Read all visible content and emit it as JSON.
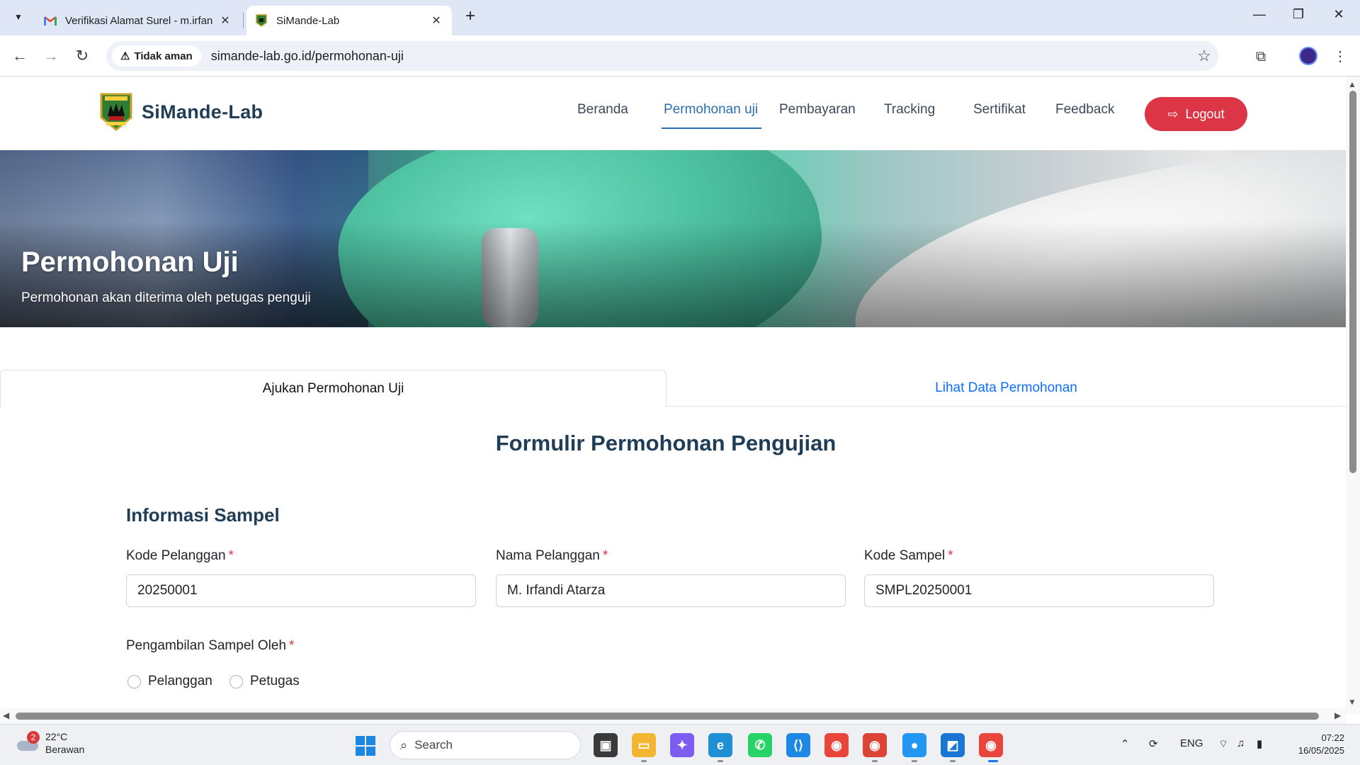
{
  "browser": {
    "tabs": [
      {
        "title": "Verifikasi Alamat Surel - m.irfan",
        "favicon": "gmail-icon",
        "active": false
      },
      {
        "title": "SiMande-Lab",
        "favicon": "simande-logo-icon",
        "active": true
      }
    ],
    "security_label": "Tidak aman",
    "url": "simande-lab.go.id/permohonan-uji"
  },
  "site": {
    "brand": "SiMande-Lab",
    "nav": {
      "beranda": "Beranda",
      "permohonan": "Permohonan uji",
      "pembayaran": "Pembayaran",
      "tracking": "Tracking",
      "sertifikat": "Sertifikat",
      "feedback": "Feedback"
    },
    "active_nav": "Permohonan uji",
    "logout": "Logout",
    "accent_color": "#dc3545",
    "link_color": "#2a6fb0"
  },
  "hero": {
    "title": "Permohonan Uji",
    "subtitle": "Permohonan akan diterima oleh petugas penguji"
  },
  "page_tabs": {
    "submit": "Ajukan Permohonan Uji",
    "view": "Lihat Data Permohonan"
  },
  "form": {
    "title": "Formulir Permohonan Pengujian",
    "section": "Informasi Sampel",
    "required_mark": "*",
    "fields": {
      "kode_pelanggan": {
        "label": "Kode Pelanggan",
        "value": "20250001"
      },
      "nama_pelanggan": {
        "label": "Nama Pelanggan",
        "value": "M. Irfandi Atarza"
      },
      "kode_sampel": {
        "label": "Kode Sampel",
        "value": "SMPL20250001"
      }
    },
    "pengambilan": {
      "label": "Pengambilan Sampel Oleh",
      "options": [
        "Pelanggan",
        "Petugas"
      ]
    }
  },
  "taskbar": {
    "weather_temp": "22°C",
    "weather_desc": "Berawan",
    "weather_badge": "2",
    "search_placeholder": "Search",
    "language": "ENG",
    "time": "07:22",
    "date": "16/05/2025"
  }
}
